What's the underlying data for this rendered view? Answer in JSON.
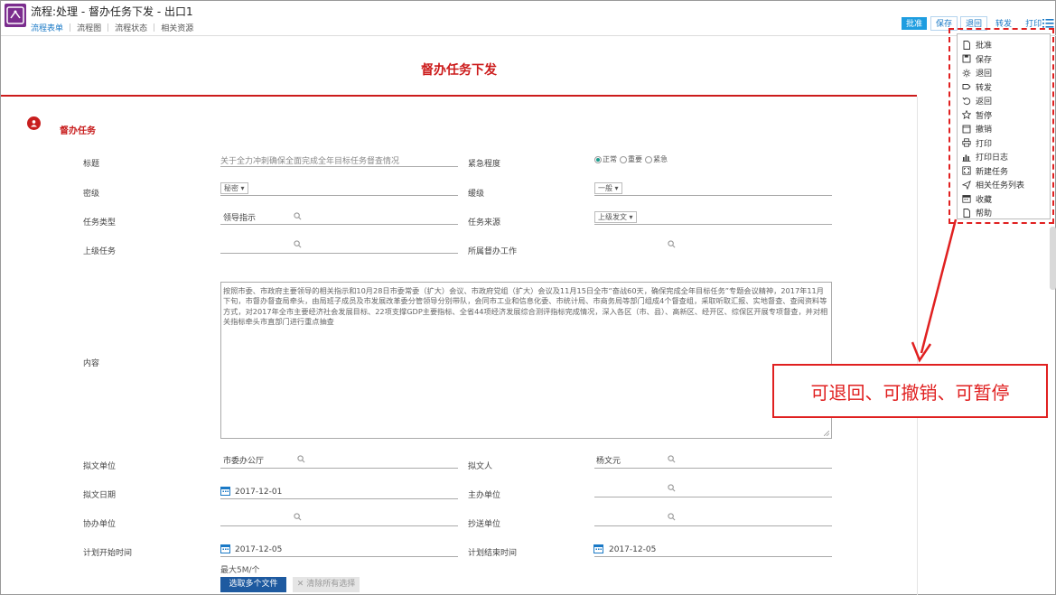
{
  "app": {
    "title": "流程:处理 - 督办任务下发 - 出口1",
    "nav": [
      "流程表单",
      "流程图",
      "流程状态",
      "相关资源"
    ]
  },
  "toolbar": {
    "approve": "批准",
    "save": "保存",
    "return": "退回",
    "forward": "转发",
    "print": "打印"
  },
  "form": {
    "title": "督办任务下发",
    "section": "督办任务",
    "labels": {
      "subject": "标题",
      "urgency": "紧急程度",
      "secret": "密级",
      "priority": "缓级",
      "task_type": "任务类型",
      "task_source": "任务来源",
      "parent_task": "上级任务",
      "related_work": "所属督办工作",
      "content": "内容",
      "draft_unit": "拟文单位",
      "drafter": "拟文人",
      "draft_date": "拟文日期",
      "host_unit": "主办单位",
      "co_unit": "协办单位",
      "cc_unit": "抄送单位",
      "plan_start": "计划开始时间",
      "plan_end": "计划结束时间"
    },
    "values": {
      "subject": "关于全力冲刺确保全面完成全年目标任务督查情况",
      "urgency_options": [
        "正常",
        "重要",
        "紧急"
      ],
      "urgency_selected": "正常",
      "secret": "秘密",
      "priority": "一般",
      "task_type": "领导指示",
      "task_source": "上级发文",
      "content": "按照市委、市政府主要领导的相关指示和10月28日市委常委（扩大）会议、市政府党组（扩大）会议及11月15日全市“奋战60天，确保完成全年目标任务”专题会议精神，2017年11月下旬，市督办督查局牵头，由局班子成员及市发展改革委分管领导分别带队，会同市工业和信息化委、市统计局、市商务局等部门组成4个督查组，采取听取汇报、实地督查、查阅资料等方式，对2017年全市主要经济社会发展目标、22项支撑GDP主要指标、全省44项经济发展综合测评指标完成情况，深入各区（市、县）、高新区、经开区、综保区开展专项督查，并对相关指标牵头市直部门进行重点抽查",
      "draft_unit": "市委办公厅",
      "drafter": "杨文元",
      "draft_date": "2017-12-01",
      "plan_start": "2017-12-05",
      "plan_end": "2017-12-05"
    },
    "upload": {
      "hint": "最大5M/个",
      "select_label": "选取多个文件",
      "clear_label": "清除所有选择"
    }
  },
  "menu": {
    "items": [
      {
        "label": "批准",
        "icon": "document-icon"
      },
      {
        "label": "保存",
        "icon": "save-icon"
      },
      {
        "label": "退回",
        "icon": "sun-icon"
      },
      {
        "label": "转发",
        "icon": "tag-icon"
      },
      {
        "label": "返回",
        "icon": "undo-icon"
      },
      {
        "label": "暂停",
        "icon": "star-icon"
      },
      {
        "label": "撤销",
        "icon": "square-icon"
      },
      {
        "label": "打印",
        "icon": "printer-icon"
      },
      {
        "label": "打印日志",
        "icon": "bar-chart-icon"
      },
      {
        "label": "新建任务",
        "icon": "expand-icon"
      },
      {
        "label": "相关任务列表",
        "icon": "send-icon"
      },
      {
        "label": "收藏",
        "icon": "calendar-icon"
      },
      {
        "label": "帮助",
        "icon": "help-doc-icon"
      }
    ]
  },
  "annotation": {
    "text": "可退回、可撤销、可暂停",
    "color": "#e02020"
  }
}
